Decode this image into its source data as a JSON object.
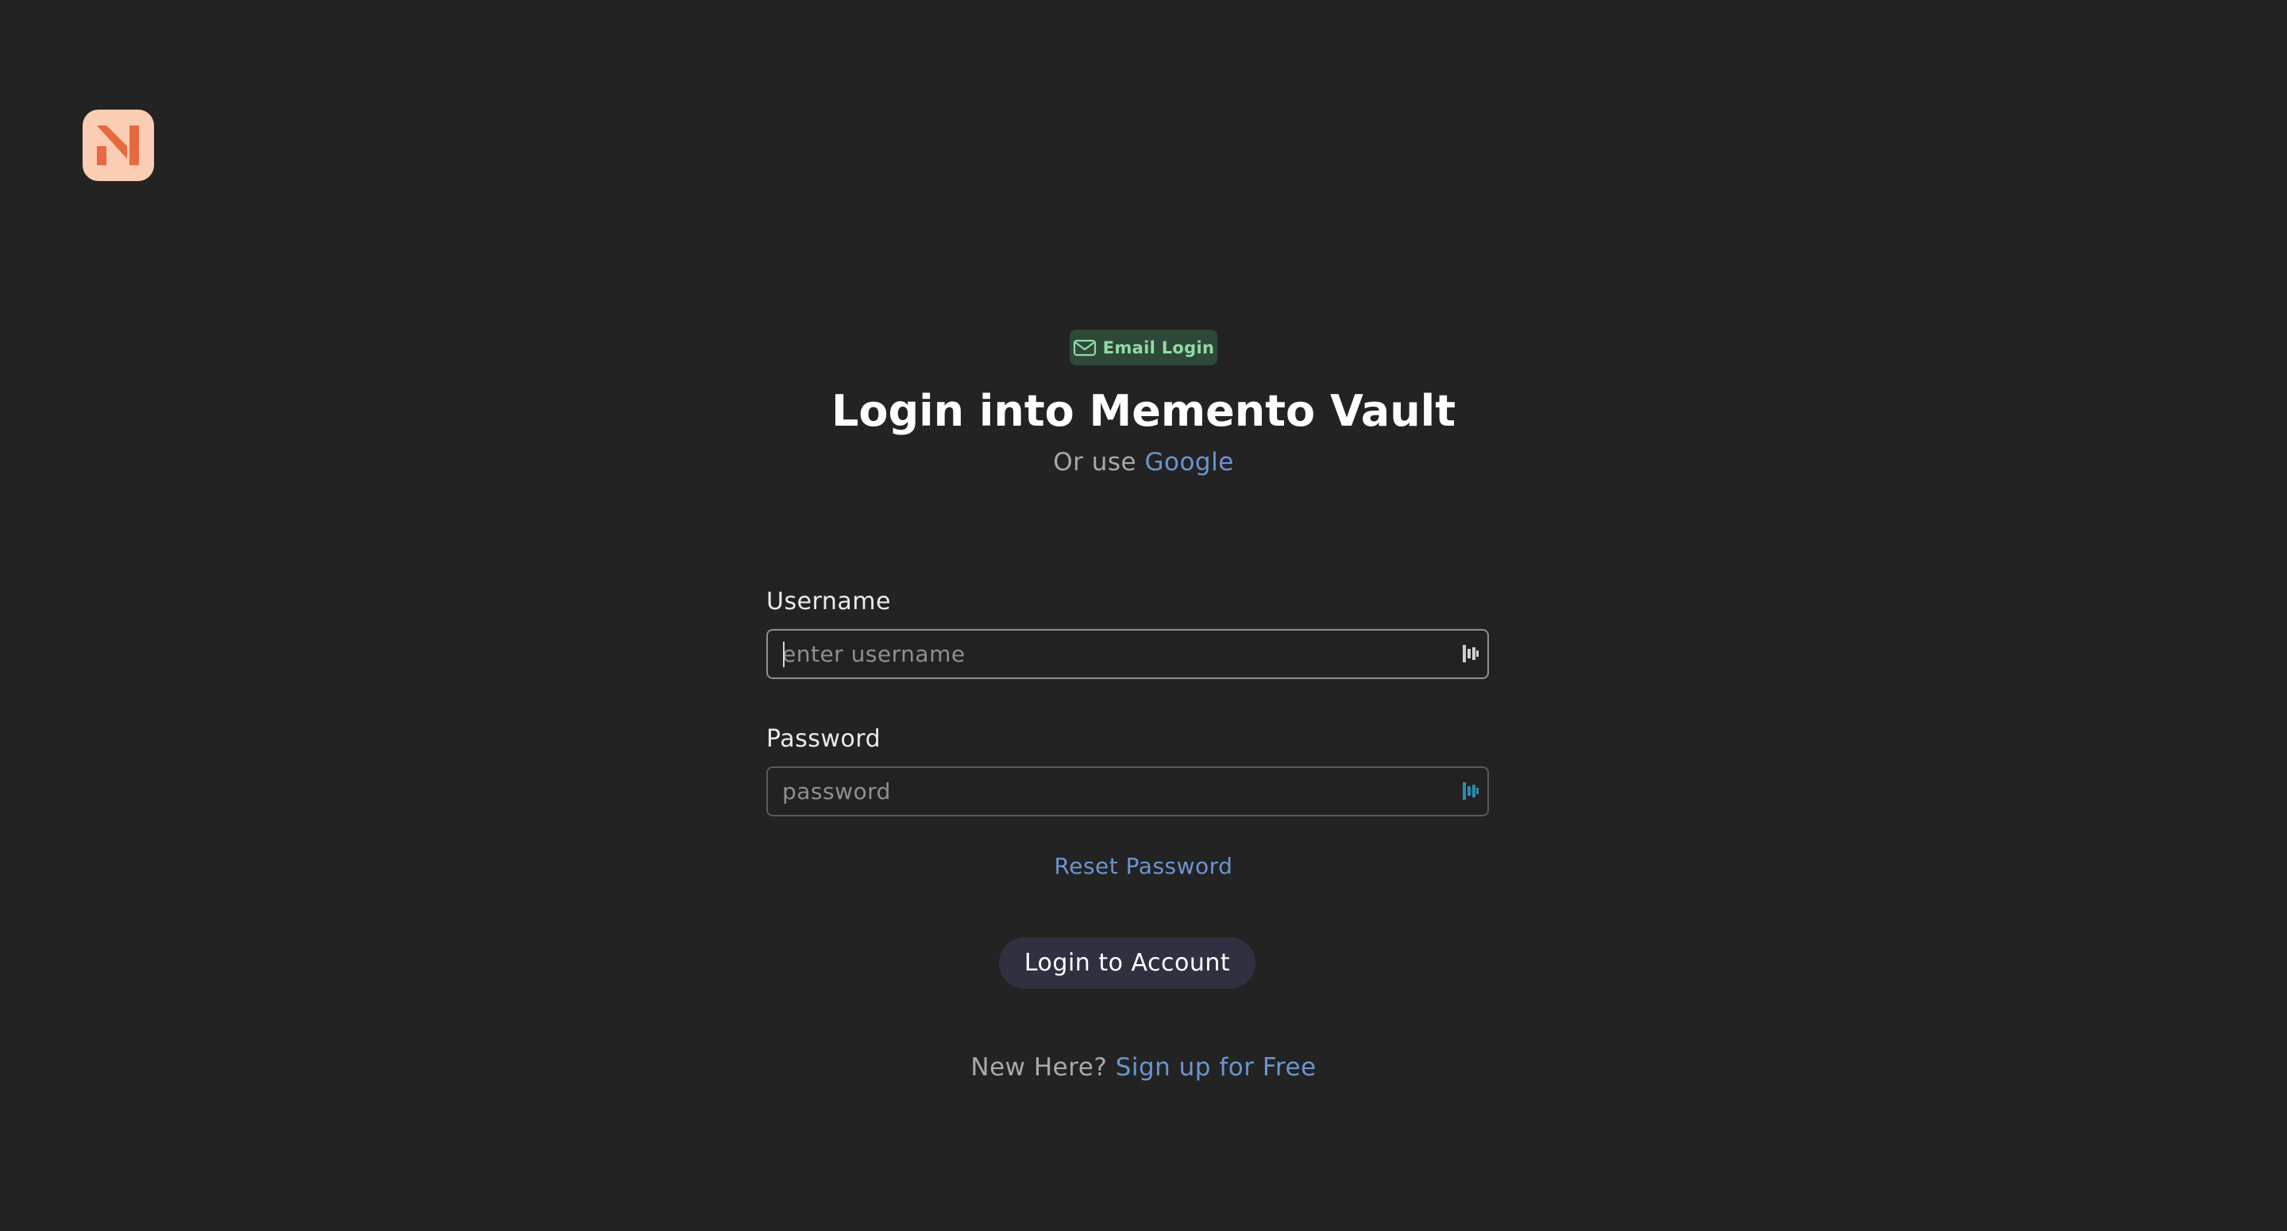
{
  "app": {
    "logo": "memento-vault-logo",
    "accent_color": "#e8683f",
    "background_color": "#232323"
  },
  "badge": {
    "icon": "mail-icon",
    "label": "Email Login",
    "color": "#93d9a8"
  },
  "header": {
    "title": "Login into Memento Vault",
    "alt_prefix": "Or use",
    "alt_link": "Google"
  },
  "form": {
    "username": {
      "label": "Username",
      "placeholder": "enter username",
      "value": ""
    },
    "password": {
      "label": "Password",
      "placeholder": "password",
      "value": ""
    },
    "field_icon": "password-manager-icon",
    "reset_link": "Reset Password",
    "submit_label": "Login to Account"
  },
  "footer": {
    "prompt": "New Here?",
    "signup_link": "Sign up for Free"
  },
  "link_color": "#6d94cf"
}
